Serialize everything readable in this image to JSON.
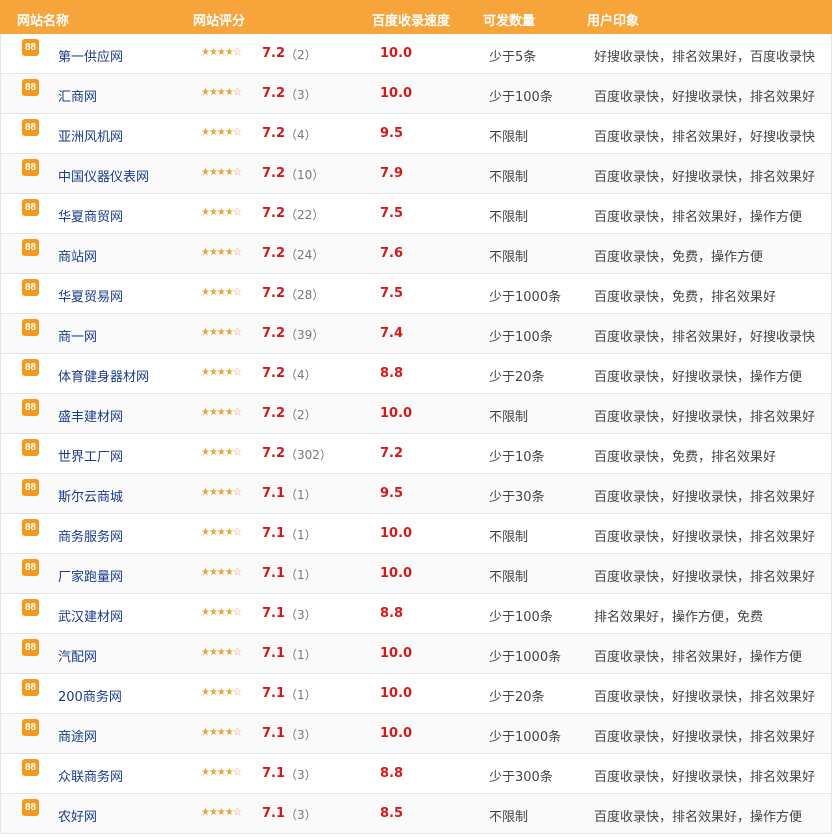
{
  "header": {
    "col_name": "网站名称",
    "col_rating": "网站评分",
    "col_speed": "百度收录速度",
    "col_limit": "可发数量",
    "col_impression": "用户印象"
  },
  "badge_text": "88",
  "colors": {
    "header_bg": "#f7a43a",
    "score": "#d21a1a",
    "link": "#1a3a8c",
    "badge": "#f39a1e"
  },
  "rows": [
    {
      "name": "第一供应网",
      "stars": "★★★★☆",
      "score": "7.2",
      "count": "（2）",
      "speed": "10.0",
      "limit": "少于5条",
      "impression": "好搜收录快，排名效果好，百度收录快"
    },
    {
      "name": "汇商网",
      "stars": "★★★★☆",
      "score": "7.2",
      "count": "（3）",
      "speed": "10.0",
      "limit": "少于100条",
      "impression": "百度收录快，好搜收录快，排名效果好"
    },
    {
      "name": "亚洲风机网",
      "stars": "★★★★☆",
      "score": "7.2",
      "count": "（4）",
      "speed": "9.5",
      "limit": "不限制",
      "impression": "百度收录快，排名效果好，好搜收录快"
    },
    {
      "name": "中国仪器仪表网",
      "stars": "★★★★☆",
      "score": "7.2",
      "count": "（10）",
      "speed": "7.9",
      "limit": "不限制",
      "impression": "百度收录快，好搜收录快，排名效果好"
    },
    {
      "name": "华夏商贸网",
      "stars": "★★★★☆",
      "score": "7.2",
      "count": "（22）",
      "speed": "7.5",
      "limit": "不限制",
      "impression": "百度收录快，排名效果好，操作方便"
    },
    {
      "name": "商站网",
      "stars": "★★★★☆",
      "score": "7.2",
      "count": "（24）",
      "speed": "7.6",
      "limit": "不限制",
      "impression": "百度收录快，免费，操作方便"
    },
    {
      "name": "华夏贸易网",
      "stars": "★★★★☆",
      "score": "7.2",
      "count": "（28）",
      "speed": "7.5",
      "limit": "少于1000条",
      "impression": "百度收录快，免费，排名效果好"
    },
    {
      "name": "商一网",
      "stars": "★★★★☆",
      "score": "7.2",
      "count": "（39）",
      "speed": "7.4",
      "limit": "少于100条",
      "impression": "百度收录快，排名效果好，好搜收录快"
    },
    {
      "name": "体育健身器材网",
      "stars": "★★★★☆",
      "score": "7.2",
      "count": "（4）",
      "speed": "8.8",
      "limit": "少于20条",
      "impression": "百度收录快，好搜收录快，操作方便"
    },
    {
      "name": "盛丰建材网",
      "stars": "★★★★☆",
      "score": "7.2",
      "count": "（2）",
      "speed": "10.0",
      "limit": "不限制",
      "impression": "百度收录快，好搜收录快，排名效果好"
    },
    {
      "name": "世界工厂网",
      "stars": "★★★★☆",
      "score": "7.2",
      "count": "（302）",
      "speed": "7.2",
      "limit": "少于10条",
      "impression": "百度收录快，免费，排名效果好"
    },
    {
      "name": "斯尔云商城",
      "stars": "★★★★☆",
      "score": "7.1",
      "count": "（1）",
      "speed": "9.5",
      "limit": "少于30条",
      "impression": "百度收录快，好搜收录快，排名效果好"
    },
    {
      "name": "商务服务网",
      "stars": "★★★★☆",
      "score": "7.1",
      "count": "（1）",
      "speed": "10.0",
      "limit": "不限制",
      "impression": "百度收录快，好搜收录快，排名效果好"
    },
    {
      "name": "厂家跑量网",
      "stars": "★★★★☆",
      "score": "7.1",
      "count": "（1）",
      "speed": "10.0",
      "limit": "不限制",
      "impression": "百度收录快，好搜收录快，排名效果好"
    },
    {
      "name": "武汉建材网",
      "stars": "★★★★☆",
      "score": "7.1",
      "count": "（3）",
      "speed": "8.8",
      "limit": "少于100条",
      "impression": "排名效果好，操作方便，免费"
    },
    {
      "name": "汽配网",
      "stars": "★★★★☆",
      "score": "7.1",
      "count": "（1）",
      "speed": "10.0",
      "limit": "少于1000条",
      "impression": "百度收录快，排名效果好，操作方便"
    },
    {
      "name": "200商务网",
      "stars": "★★★★☆",
      "score": "7.1",
      "count": "（1）",
      "speed": "10.0",
      "limit": "少于20条",
      "impression": "百度收录快，好搜收录快，排名效果好"
    },
    {
      "name": "商途网",
      "stars": "★★★★☆",
      "score": "7.1",
      "count": "（3）",
      "speed": "10.0",
      "limit": "少于1000条",
      "impression": "百度收录快，好搜收录快，排名效果好"
    },
    {
      "name": "众联商务网",
      "stars": "★★★★☆",
      "score": "7.1",
      "count": "（3）",
      "speed": "8.8",
      "limit": "少于300条",
      "impression": "百度收录快，好搜收录快，排名效果好"
    },
    {
      "name": "农好网",
      "stars": "★★★★☆",
      "score": "7.1",
      "count": "（3）",
      "speed": "8.5",
      "limit": "不限制",
      "impression": "百度收录快，排名效果好，操作方便"
    }
  ]
}
